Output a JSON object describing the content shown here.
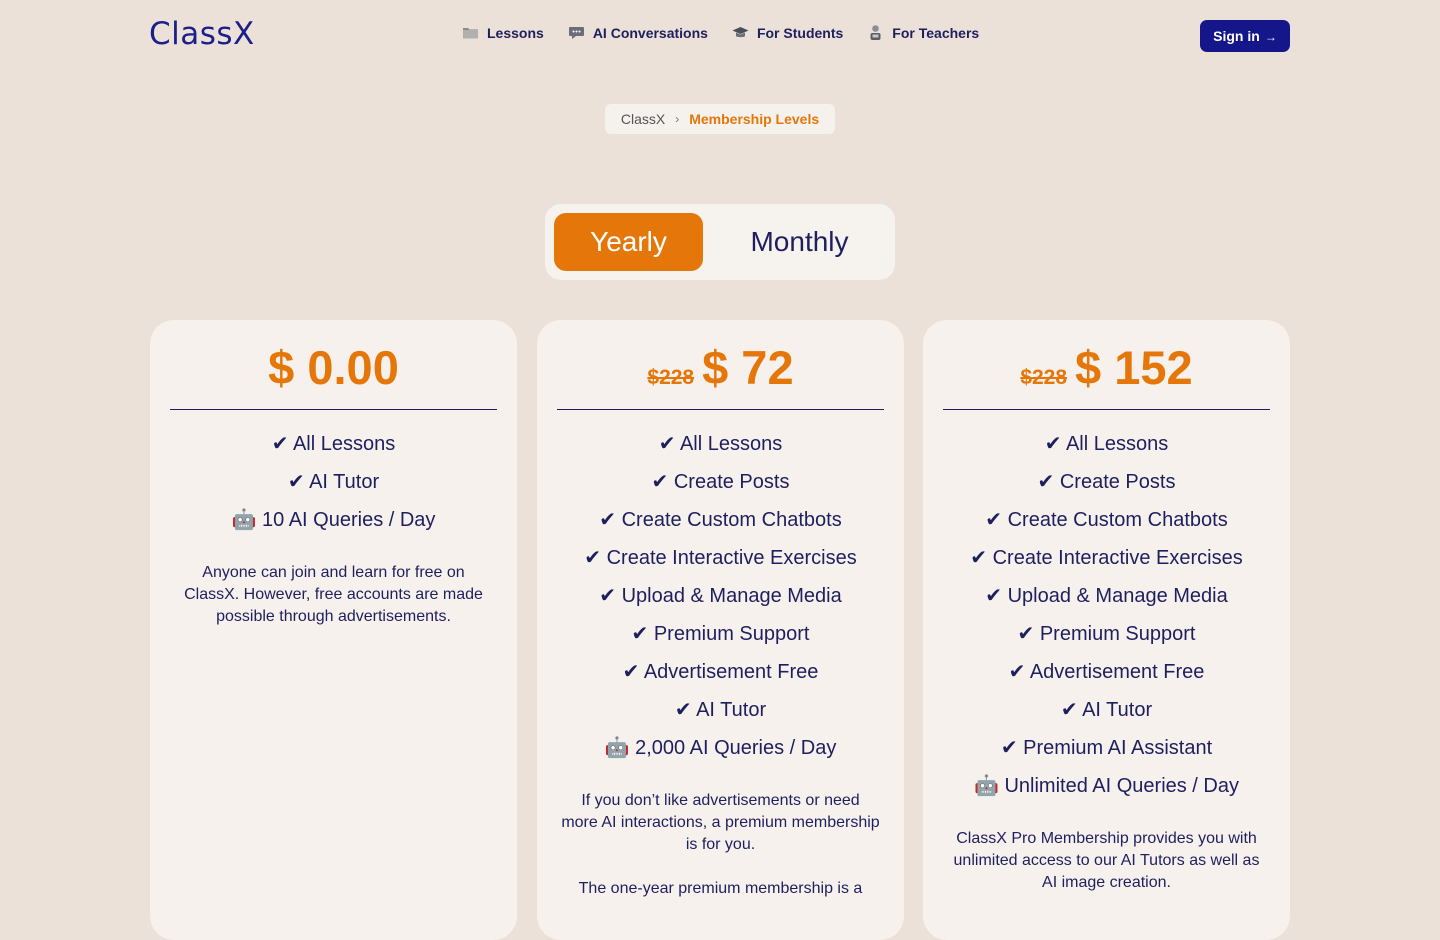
{
  "header": {
    "logo": "ClassX",
    "nav": [
      {
        "label": "Lessons",
        "icon": "folder-icon"
      },
      {
        "label": "AI Conversations",
        "icon": "chat-bubble-icon"
      },
      {
        "label": "For Students",
        "icon": "graduation-cap-icon"
      },
      {
        "label": "For Teachers",
        "icon": "teacher-icon"
      }
    ],
    "signin": {
      "label": "Sign in",
      "arrow": "→"
    }
  },
  "breadcrumb": {
    "home": "ClassX",
    "separator": "›",
    "current": "Membership Levels"
  },
  "billing_toggle": {
    "options": [
      "Yearly",
      "Monthly"
    ],
    "selected": "Yearly"
  },
  "plans": [
    {
      "old_price": "",
      "price": "$ 0.00",
      "features": [
        "✔ All Lessons",
        "✔ AI Tutor",
        "🤖 10 AI Queries / Day"
      ],
      "description": [
        "Anyone can join and learn for free on ClassX. However, free accounts are made possible through advertisements."
      ]
    },
    {
      "old_price": "$228",
      "price": "$ 72",
      "features": [
        "✔ All Lessons",
        "✔ Create Posts",
        "✔ Create Custom Chatbots",
        "✔ Create Interactive Exercises",
        "✔ Upload & Manage Media",
        "✔ Premium Support",
        "✔ Advertisement Free",
        "✔ AI Tutor",
        "🤖 2,000 AI Queries / Day"
      ],
      "description": [
        "If you don’t like advertisements or need more AI interactions, a premium membership is for you.",
        "The one-year premium membership is a"
      ]
    },
    {
      "old_price": "$228",
      "price": "$ 152",
      "features": [
        "✔ All Lessons",
        "✔ Create Posts",
        "✔ Create Custom Chatbots",
        "✔ Create Interactive Exercises",
        "✔ Upload & Manage Media",
        "✔ Premium Support",
        "✔ Advertisement Free",
        "✔ AI Tutor",
        "✔ Premium AI Assistant",
        "🤖 Unlimited AI Queries / Day"
      ],
      "description": [
        "ClassX Pro Membership provides you with unlimited access to our AI Tutors as well as AI image creation."
      ]
    }
  ],
  "colors": {
    "accent": "#e5770a",
    "brand": "#14168a",
    "text": "#1e1f5e",
    "background": "#ebe1d8",
    "card": "#f6f1ed"
  }
}
